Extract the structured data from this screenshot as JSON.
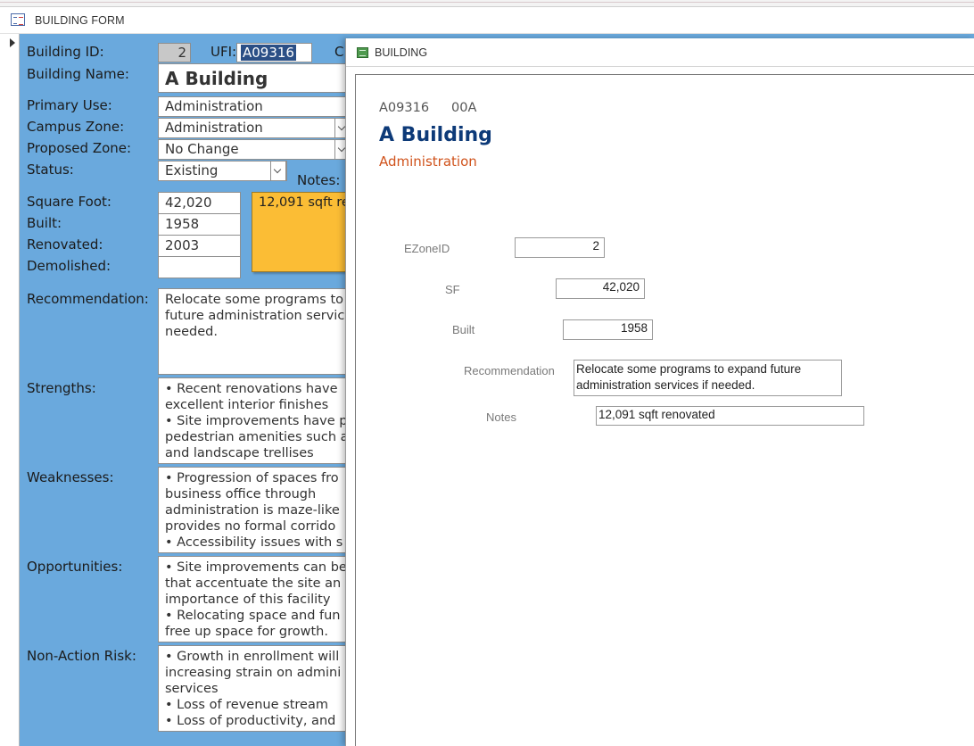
{
  "form_window": {
    "title": "BUILDING FORM",
    "icon": "form-icon"
  },
  "form": {
    "building_id_label": "Building ID:",
    "building_id": "2",
    "ufi_label": "UFI:",
    "ufi": "A09316",
    "cutoff_label": "C",
    "building_name_label": "Building Name:",
    "building_name": "A Building",
    "primary_use_label": "Primary Use:",
    "primary_use": "Administration",
    "campus_zone_label": "Campus Zone:",
    "campus_zone": "Administration",
    "proposed_zone_label": "Proposed Zone:",
    "proposed_zone": "No Change",
    "status_label": "Status:",
    "status": "Existing",
    "notes_label": "Notes:",
    "notes": "12,091 sqft re",
    "square_foot_label": "Square Foot:",
    "square_foot": "42,020",
    "built_label": "Built:",
    "built": "1958",
    "renovated_label": "Renovated:",
    "renovated": "2003",
    "demolished_label": "Demolished:",
    "demolished": "",
    "recommendation_label": "Recommendation:",
    "recommendation_lines": [
      "Relocate some programs to",
      "future administration servic",
      "needed."
    ],
    "strengths_label": "Strengths:",
    "strengths_lines": [
      "• Recent renovations have",
      "excellent interior finishes",
      "• Site improvements have p",
      "pedestrian amenities such a",
      "and landscape trellises"
    ],
    "weaknesses_label": "Weaknesses:",
    "weaknesses_lines": [
      "• Progression of spaces fro",
      "business office through",
      "administration is maze-like",
      "provides no formal corrido",
      "• Accessibility issues with s"
    ],
    "opportunities_label": "Opportunities:",
    "opportunities_lines": [
      "• Site improvements can be",
      "that accentuate the site an",
      "importance of this facility",
      "• Relocating space and fun",
      "free up space for growth."
    ],
    "nonaction_label": "Non-Action Risk:",
    "nonaction_lines": [
      "• Growth in enrollment will",
      "increasing strain on admini",
      "services",
      "• Loss of revenue stream",
      "• Loss of productivity, and"
    ]
  },
  "report_window": {
    "title": "BUILDING",
    "icon": "report-icon",
    "ufi": "A09316",
    "code": "00A",
    "building_name": "A Building",
    "primary_use": "Administration",
    "ezone_label": "EZoneID",
    "ezone_value": "2",
    "sf_label": "SF",
    "sf_value": "42,020",
    "built_label": "Built",
    "built_value": "1958",
    "recommendation_label": "Recommendation",
    "recommendation_lines": [
      "Relocate some programs to expand future",
      "administration services if needed."
    ],
    "notes_label": "Notes",
    "notes_value": "12,091 sqft renovated"
  },
  "colors": {
    "form_background": "#6aa9dd",
    "notes_highlight": "#fbbd35",
    "report_title": "#0d3a78",
    "report_subtitle": "#d0531c"
  }
}
